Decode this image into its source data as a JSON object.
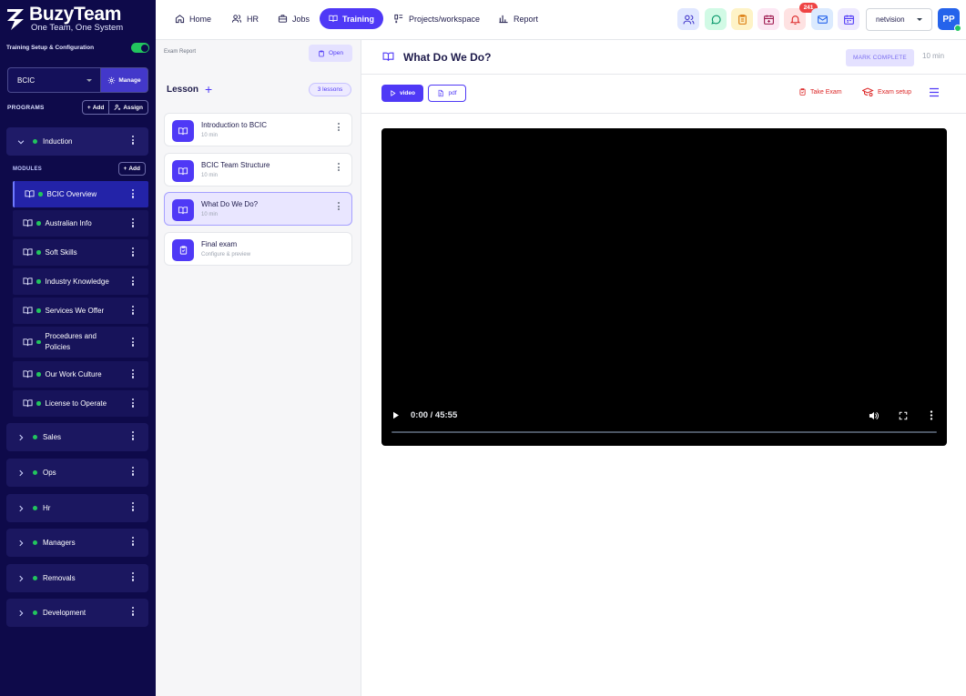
{
  "brand": {
    "name": "BuzyTeam",
    "tagline": "One Team, One System"
  },
  "sidebar": {
    "setup_label": "Training Setup & Configuration",
    "setup_toggle_on": true,
    "org_select": "BCIC",
    "manage_label": "Manage",
    "programs_label": "PROGRAMS",
    "add_label": "Add",
    "assign_label": "Assign",
    "modules_label": "MODULES",
    "modules_add_label": "Add",
    "programs": [
      {
        "name": "Induction",
        "expanded": true
      },
      {
        "name": "Sales"
      },
      {
        "name": "Ops"
      },
      {
        "name": "Hr"
      },
      {
        "name": "Managers"
      },
      {
        "name": "Removals"
      },
      {
        "name": "Development"
      }
    ],
    "modules": [
      {
        "name": "BCIC Overview",
        "active": true
      },
      {
        "name": "Australian Info"
      },
      {
        "name": "Soft Skills"
      },
      {
        "name": "Industry Knowledge"
      },
      {
        "name": "Services We Offer"
      },
      {
        "name": "Procedures and Policies"
      },
      {
        "name": "Our Work Culture"
      },
      {
        "name": "License to Operate"
      }
    ]
  },
  "topnav": {
    "items": [
      "Home",
      "HR",
      "Jobs",
      "Training",
      "Projects/workspace",
      "Report"
    ],
    "active": "Training",
    "notification_count": "241",
    "company_select": "netvision",
    "avatar_initials": "PP"
  },
  "lessons_panel": {
    "exam_report_label": "Exam Report",
    "open_label": "Open",
    "heading": "Lesson",
    "count_label": "3 lessons",
    "lessons": [
      {
        "title": "Introduction to BCIC",
        "subtitle": "10 min"
      },
      {
        "title": "BCIC Team Structure",
        "subtitle": "10 min"
      },
      {
        "title": "What Do We Do?",
        "subtitle": "10 min",
        "active": true
      },
      {
        "title": "Final exam",
        "subtitle": "Configure & preview"
      }
    ]
  },
  "content": {
    "title": "What Do We Do?",
    "mark_complete_label": "MARK COMPLETE",
    "duration": "10 min",
    "video_tab_label": "video",
    "pdf_tab_label": "pdf",
    "take_exam_label": "Take Exam",
    "exam_setup_label": "Exam setup",
    "player": {
      "time": "0:00 / 45:55"
    }
  },
  "colors": {
    "sidebar_bg": "#0e0a4a",
    "accent": "#4f39f6",
    "status_green": "#22c55e",
    "danger": "#dc2626"
  }
}
